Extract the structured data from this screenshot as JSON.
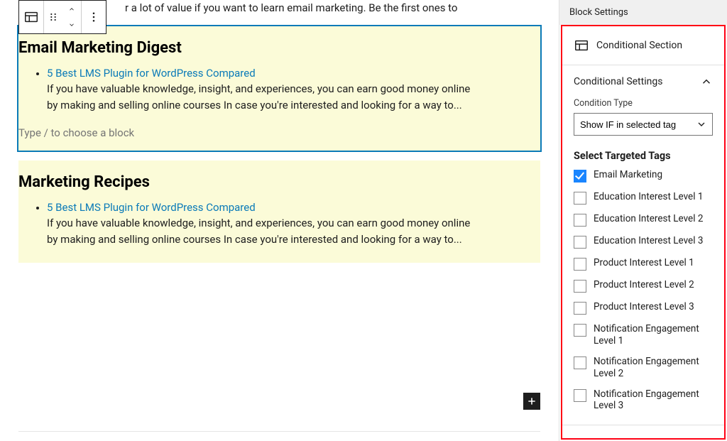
{
  "editor": {
    "intro_fragment": "r a lot of value if you want to learn email marketing. Be the first ones to",
    "appender_placeholder": "Type / to choose a block",
    "sections": [
      {
        "heading": "Email Marketing Digest",
        "posts": [
          {
            "title": "5 Best LMS Plugin for WordPress Compared",
            "excerpt": "If you have valuable knowledge, insight, and experiences, you can earn good money online by making and selling online courses In case you're interested and looking for a way to..."
          }
        ]
      },
      {
        "heading": "Marketing Recipes",
        "posts": [
          {
            "title": "5 Best LMS Plugin for WordPress Compared",
            "excerpt": "If you have valuable knowledge, insight, and experiences, you can earn good money online by making and selling online courses In case you're interested and looking for a way to..."
          }
        ]
      }
    ]
  },
  "sidebar": {
    "tab_label": "Block Settings",
    "section_name": "Conditional Section",
    "panel_title": "Conditional Settings",
    "condition_type_label": "Condition Type",
    "condition_type_value": "Show IF in selected tag",
    "tags_heading": "Select Targeted Tags",
    "tags": [
      {
        "label": "Email Marketing",
        "checked": true
      },
      {
        "label": "Education Interest Level 1",
        "checked": false
      },
      {
        "label": "Education Interest Level 2",
        "checked": false
      },
      {
        "label": "Education Interest Level 3",
        "checked": false
      },
      {
        "label": "Product Interest Level 1",
        "checked": false
      },
      {
        "label": "Product Interest Level 2",
        "checked": false
      },
      {
        "label": "Product Interest Level 3",
        "checked": false
      },
      {
        "label": "Notification Engagement Level 1",
        "checked": false
      },
      {
        "label": "Notification Engagement Level 2",
        "checked": false
      },
      {
        "label": "Notification Engagement Level 3",
        "checked": false
      }
    ]
  }
}
